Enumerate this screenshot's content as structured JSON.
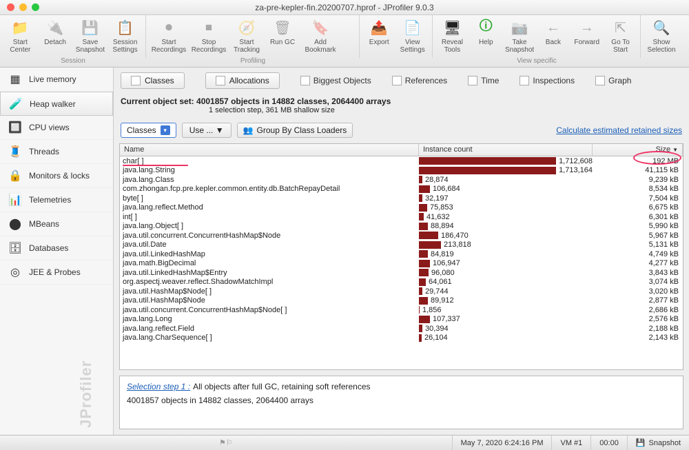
{
  "window": {
    "title": "za-pre-kepler-fin.20200707.hprof - JProfiler 9.0.3"
  },
  "toolbar": {
    "groups": [
      "Session",
      "Profiling",
      "",
      "View specific",
      ""
    ],
    "buttons": {
      "start_center": "Start\nCenter",
      "detach": "Detach",
      "save_snapshot": "Save\nSnapshot",
      "session_settings": "Session\nSettings",
      "start_recordings": "Start\nRecordings",
      "stop_recordings": "Stop\nRecordings",
      "start_tracking": "Start\nTracking",
      "run_gc": "Run GC",
      "add_bookmark": "Add\nBookmark",
      "export": "Export",
      "view_settings": "View\nSettings",
      "reveal_tools": "Reveal\nTools",
      "help": "Help",
      "take_snapshot": "Take\nSnapshot",
      "back": "Back",
      "forward": "Forward",
      "goto_start": "Go To\nStart",
      "show_selection": "Show\nSelection"
    }
  },
  "sidebar": {
    "items": [
      {
        "icon": "cubes",
        "label": "Live memory"
      },
      {
        "icon": "vial",
        "label": "Heap walker"
      },
      {
        "icon": "chip",
        "label": "CPU views"
      },
      {
        "icon": "spool",
        "label": "Threads"
      },
      {
        "icon": "lock",
        "label": "Monitors & locks"
      },
      {
        "icon": "gauge",
        "label": "Telemetries"
      },
      {
        "icon": "bean",
        "label": "MBeans"
      },
      {
        "icon": "db",
        "label": "Databases"
      },
      {
        "icon": "probe",
        "label": "JEE & Probes"
      }
    ],
    "watermark": "JProfiler"
  },
  "viewtabs": {
    "classes": "Classes",
    "allocations": "Allocations",
    "biggest": "Biggest Objects",
    "references": "References",
    "time": "Time",
    "inspections": "Inspections",
    "graph": "Graph"
  },
  "summary": {
    "line1": "Current object set:  4001857 objects in 14882 classes, 2064400 arrays",
    "line2": "1 selection step, 361 MB shallow size"
  },
  "controls": {
    "classes": "Classes",
    "use": "Use ... ",
    "group": "Group By Class Loaders",
    "calc": "Calculate estimated retained sizes"
  },
  "table": {
    "headers": {
      "name": "Name",
      "count": "Instance count",
      "size": "Size"
    },
    "rows": [
      {
        "name": "char[ ]",
        "count": "1,712,608",
        "bar": 250,
        "size": "192 MB"
      },
      {
        "name": "java.lang.String",
        "count": "1,713,164",
        "bar": 250,
        "size": "41,115 kB"
      },
      {
        "name": "java.lang.Class",
        "count": "28,874",
        "bar": 5,
        "size": "9,239 kB"
      },
      {
        "name": "com.zhongan.fcp.pre.kepler.common.entity.db.BatchRepayDetail",
        "count": "106,684",
        "bar": 16,
        "size": "8,534 kB"
      },
      {
        "name": "byte[ ]",
        "count": "32,197",
        "bar": 5,
        "size": "7,504 kB"
      },
      {
        "name": "java.lang.reflect.Method",
        "count": "75,853",
        "bar": 12,
        "size": "6,675 kB"
      },
      {
        "name": "int[ ]",
        "count": "41,632",
        "bar": 7,
        "size": "6,301 kB"
      },
      {
        "name": "java.lang.Object[ ]",
        "count": "88,894",
        "bar": 13,
        "size": "5,990 kB"
      },
      {
        "name": "java.util.concurrent.ConcurrentHashMap$Node",
        "count": "186,470",
        "bar": 28,
        "size": "5,967 kB"
      },
      {
        "name": "java.util.Date",
        "count": "213,818",
        "bar": 32,
        "size": "5,131 kB"
      },
      {
        "name": "java.util.LinkedHashMap",
        "count": "84,819",
        "bar": 13,
        "size": "4,749 kB"
      },
      {
        "name": "java.math.BigDecimal",
        "count": "106,947",
        "bar": 16,
        "size": "4,277 kB"
      },
      {
        "name": "java.util.LinkedHashMap$Entry",
        "count": "96,080",
        "bar": 14,
        "size": "3,843 kB"
      },
      {
        "name": "org.aspectj.weaver.reflect.ShadowMatchImpl",
        "count": "64,061",
        "bar": 10,
        "size": "3,074 kB"
      },
      {
        "name": "java.util.HashMap$Node[ ]",
        "count": "29,744",
        "bar": 5,
        "size": "3,020 kB"
      },
      {
        "name": "java.util.HashMap$Node",
        "count": "89,912",
        "bar": 13,
        "size": "2,877 kB"
      },
      {
        "name": "java.util.concurrent.ConcurrentHashMap$Node[ ]",
        "count": "1,856",
        "bar": 1,
        "size": "2,686 kB"
      },
      {
        "name": "java.lang.Long",
        "count": "107,337",
        "bar": 16,
        "size": "2,576 kB"
      },
      {
        "name": "java.lang.reflect.Field",
        "count": "30,394",
        "bar": 5,
        "size": "2,188 kB"
      },
      {
        "name": "java.lang.CharSequence[ ]",
        "count": "26,104",
        "bar": 4,
        "size": "2,143 kB"
      }
    ]
  },
  "selection": {
    "title": "Selection step 1 :",
    "desc": "All objects after full GC, retaining soft references",
    "line2": "4001857 objects in 14882 classes, 2064400 arrays"
  },
  "status": {
    "time": "May 7, 2020 6:24:16 PM",
    "vm": "VM #1",
    "elapsed": "00:00",
    "mode": "Snapshot"
  }
}
